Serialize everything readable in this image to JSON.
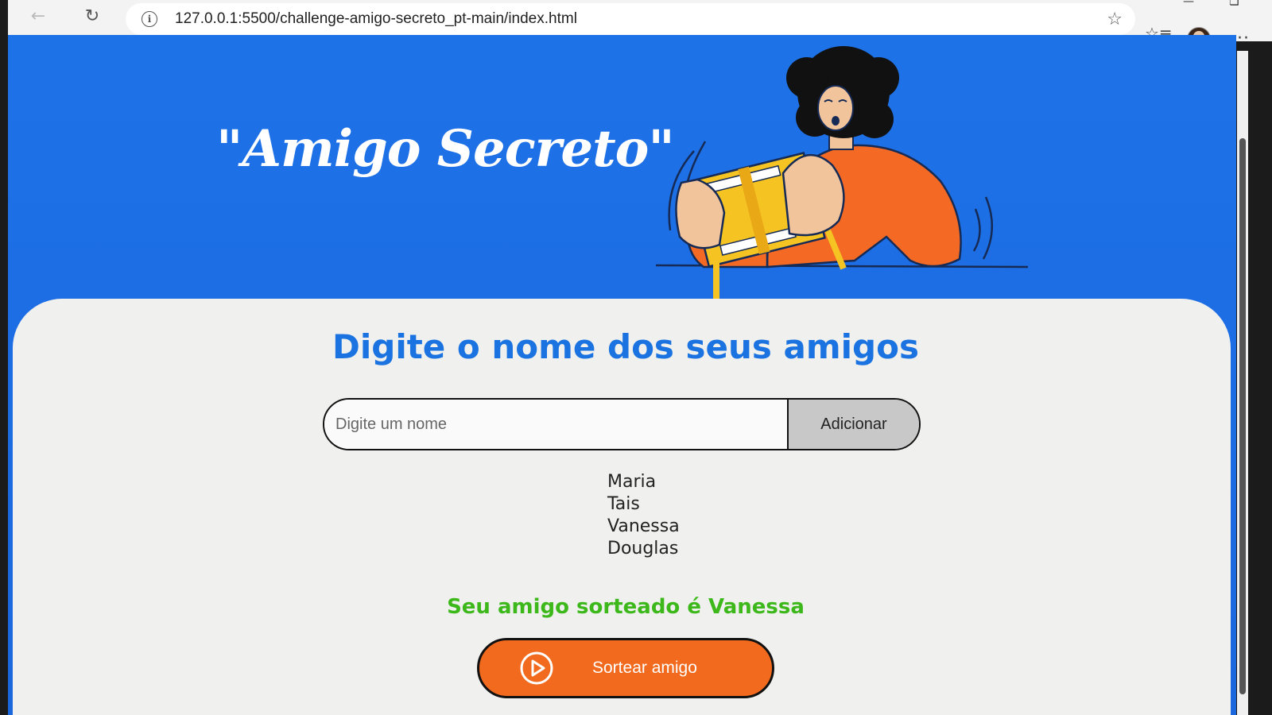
{
  "browser": {
    "url": "127.0.0.1:5500/challenge-amigo-secreto_pt-main/index.html",
    "icons": {
      "back": "back-arrow-icon",
      "reload": "reload-icon",
      "info": "info-icon",
      "favorite": "star-icon",
      "favorites_list": "favorites-list-icon",
      "profile": "avatar",
      "menu": "more-menu-icon"
    }
  },
  "header": {
    "title": "\"Amigo Secreto\""
  },
  "main": {
    "heading": "Digite o nome dos seus amigos",
    "input": {
      "placeholder": "Digite um nome",
      "value": ""
    },
    "add_button": "Adicionar",
    "friends": [
      "Maria",
      "Tais",
      "Vanessa",
      "Douglas"
    ],
    "result": "Seu amigo sorteado é Vanessa",
    "draw_button": "Sortear amigo"
  },
  "colors": {
    "header_blue": "#1e72e8",
    "heading_blue": "#1a73e0",
    "result_green": "#3cb81a",
    "button_orange": "#f26a1e",
    "card_bg": "#f0f0ee"
  }
}
